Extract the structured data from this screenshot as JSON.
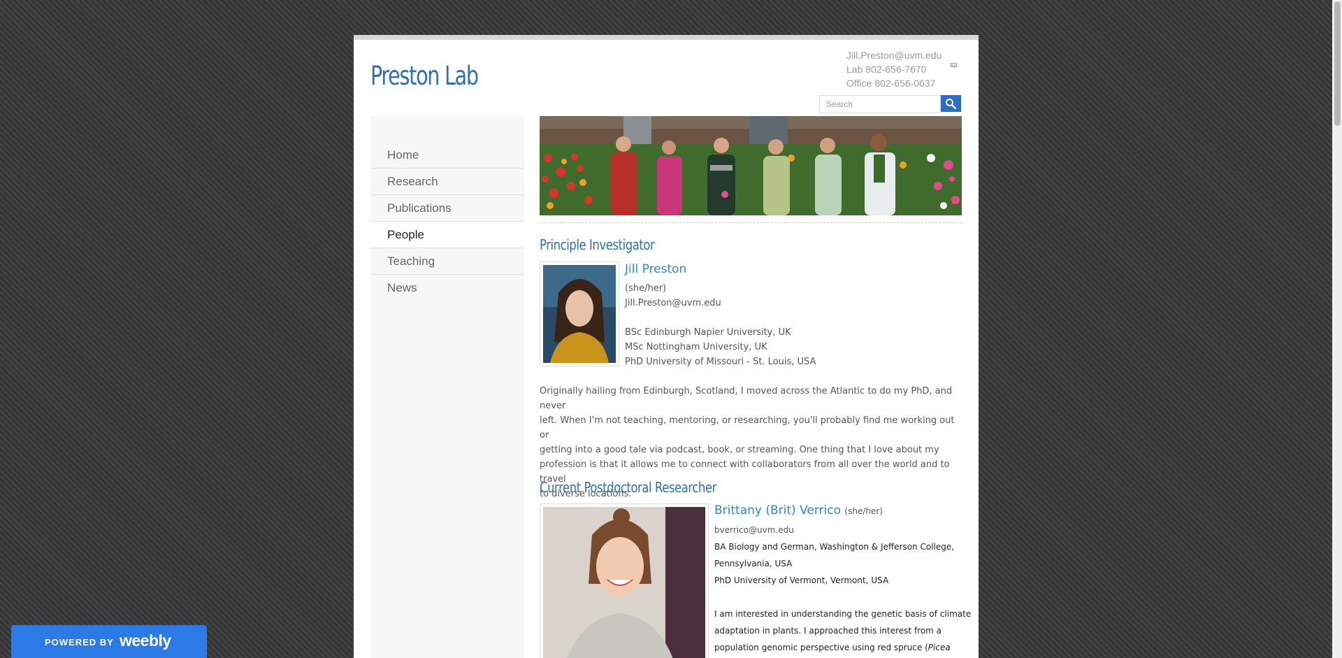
{
  "site": {
    "title": "Preston Lab"
  },
  "contact": {
    "email": "Jill.Preston@uvm.edu",
    "lab_phone": "Lab 802-656-7670",
    "office_phone": "Office 802-656-0637"
  },
  "search": {
    "placeholder": "Search"
  },
  "nav": {
    "items": [
      {
        "label": "Home"
      },
      {
        "label": "Research"
      },
      {
        "label": "Publications"
      },
      {
        "label": "People",
        "active": true
      },
      {
        "label": "Teaching"
      },
      {
        "label": "News"
      }
    ]
  },
  "sections": {
    "pi_heading": "Principle Investigator",
    "postdoc_heading": "Current Postdoctoral Researcher"
  },
  "pi": {
    "name": "Jill Preston",
    "pronouns": "(she/her)",
    "email": "Jill.Preston@uvm.edu",
    "edu": [
      "BSc Edinburgh Napier University, UK",
      "MSc Nottingham University, UK",
      "PhD University of Missouri - St. Louis, USA"
    ],
    "bio_lines": [
      "Originally hailing from Edinburgh, Scotland, I moved across the Atlantic to do my PhD, and never",
      "left. When I'm not teaching, mentoring, or researching, you'll probably find me working out or",
      "getting into a good tale via podcast, book, or streaming. One thing that I love about my",
      "profession is that it allows me to connect with collaborators from all over the world and to travel",
      "to diverse locations."
    ]
  },
  "postdoc": {
    "name": "Brittany (Brit) Verrico",
    "pronouns": "(she/her)",
    "email": "bverrico@uvm.edu",
    "edu_lines": [
      "BA Biology and German, Washington & Jefferson College,",
      "Pennsylvania, USA",
      "PhD University of Vermont, Vermont, USA"
    ],
    "bio_lines": [
      "I am interested in understanding the genetic basis of climate",
      "adaptation in plants. I approached this interest from a",
      "population genomic perspective using red spruce ("
    ],
    "bio_italic": "Picea"
  },
  "weebly": {
    "powered_by": "POWERED BY",
    "logo": "weebly"
  },
  "colors": {
    "accent": "#2f6fb5",
    "name_link": "#2b8bc2",
    "badge": "#2b7ae8"
  }
}
